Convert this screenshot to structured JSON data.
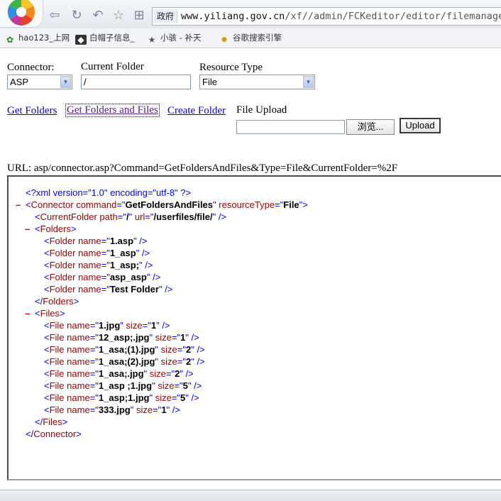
{
  "browser": {
    "address_badge": "政府",
    "url_host": "www.yiliang.gov.cn",
    "url_path": "/xf//admin/FCKeditor/editor/filemanager",
    "bookmarks": [
      "hao123_上网",
      "白帽子信息_",
      "小骇 - 补天",
      "谷歌搜索引擎"
    ]
  },
  "form": {
    "connector_label": "Connector:",
    "connector_value": "ASP",
    "current_folder_label": "Current Folder",
    "current_folder_value": "/",
    "resource_type_label": "Resource Type",
    "resource_type_value": "File",
    "get_folders": "Get Folders",
    "get_folders_and_files": "Get Folders and Files",
    "create_folder": "Create Folder",
    "file_upload_label": "File Upload",
    "browse_button": "浏览...",
    "upload_button": "Upload"
  },
  "url_line": "URL: asp/connector.asp?Command=GetFoldersAndFiles&Type=File&CurrentFolder=%2F",
  "xml": {
    "declaration": "<?xml version=\"1.0\" encoding=\"utf-8\" ?>",
    "connector_command": "GetFoldersAndFiles",
    "resource_type": "File",
    "current_folder_path": "/",
    "current_folder_url": "/userfiles/file/",
    "folders": [
      "1.asp",
      "1_asp",
      "1_asp;",
      "asp_asp",
      "Test Folder"
    ],
    "files": [
      {
        "name": "1.jpg",
        "size": "1"
      },
      {
        "name": "12_asp;.jpg",
        "size": "1"
      },
      {
        "name": "1_asa;(1).jpg",
        "size": "2"
      },
      {
        "name": "1_asa;(2).jpg",
        "size": "2"
      },
      {
        "name": "1_asa;.jpg",
        "size": "2"
      },
      {
        "name": "1_asp ;1.jpg",
        "size": "5"
      },
      {
        "name": "1_asp;1.jpg",
        "size": "5"
      },
      {
        "name": "333.jpg",
        "size": "1"
      }
    ]
  },
  "colors": {
    "link": "#0000ee",
    "visited_link": "#551a8b",
    "xml_tag": "#990000",
    "xml_punct": "#0000ff",
    "xml_minus": "#dd0000"
  }
}
